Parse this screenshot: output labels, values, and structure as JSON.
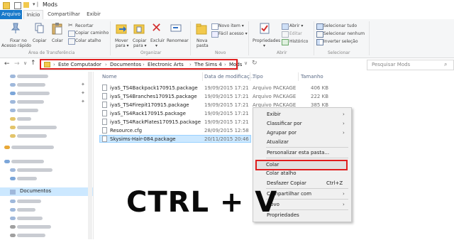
{
  "window": {
    "title": "Mods"
  },
  "ribbon_tabs": [
    "Arquivo",
    "Início",
    "Compartilhar",
    "Exibir"
  ],
  "ribbon": {
    "clipboard": {
      "pin_label_1": "Fixar no",
      "pin_label_2": "Acesso rápido",
      "copy_label": "Copiar",
      "paste_label": "Colar",
      "cut_label": "Recortar",
      "copy_path_label": "Copiar caminho",
      "paste_shortcut_label": "Colar atalho",
      "group_label": "Área de Transferência"
    },
    "organize": {
      "move_label_1": "Mover",
      "move_label_2": "para ▾",
      "copy_to_label_1": "Copiar",
      "copy_to_label_2": "para ▾",
      "delete_label_1": "Excluir",
      "delete_label_2": "▾",
      "rename_label": "Renomear",
      "group_label": "Organizar"
    },
    "new": {
      "new_folder_label_1": "Nova",
      "new_folder_label_2": "pasta",
      "new_item_label": "Novo item ▾",
      "easy_access_label": "Fácil acesso ▾",
      "group_label": "Novo"
    },
    "open": {
      "properties_label_1": "Propriedades",
      "properties_label_2": "▾",
      "open_label": "Abrir ▾",
      "edit_label": "Editar",
      "history_label": "Histórico",
      "group_label": "Abrir"
    },
    "select": {
      "select_all_label": "Selecionar tudo",
      "select_none_label": "Selecionar nenhum",
      "invert_label": "Inverter seleção",
      "group_label": "Selecionar"
    }
  },
  "address": {
    "breadcrumb": [
      "Este Computador",
      "Documentos",
      "Electronic Arts",
      "The Sims 4",
      "Mods"
    ],
    "search_placeholder": "Pesquisar Mods"
  },
  "nav_pane": {
    "selected_item": "Documentos"
  },
  "columns": {
    "name": "Nome",
    "date": "Data de modificaç...",
    "type": "Tipo",
    "size": "Tamanho"
  },
  "files": [
    {
      "name": "iyaS_TS4Backpack170915.package",
      "date": "19/09/2015 17:21",
      "type": "Arquivo PACKAGE",
      "size": "406 KB"
    },
    {
      "name": "iyaS_TS4Branches170915.package",
      "date": "19/09/2015 17:21",
      "type": "Arquivo PACKAGE",
      "size": "222 KB"
    },
    {
      "name": "iyaS_TS4Firepit170915.package",
      "date": "19/09/2015 17:21",
      "type": "Arquivo PACKAGE",
      "size": "385 KB"
    },
    {
      "name": "iyaS_TS4Rack170915.package",
      "date": "19/09/2015 17:21",
      "type": "",
      "size": ""
    },
    {
      "name": "iyaS_TS4RackPlates170915.package",
      "date": "19/09/2015 17:21",
      "type": "",
      "size": ""
    },
    {
      "name": "Resource.cfg",
      "date": "28/09/2015 12:58",
      "type": "",
      "size": ""
    },
    {
      "name": "Skysims-Hair-084.package",
      "date": "20/11/2015 20:46",
      "type": "",
      "size": ""
    }
  ],
  "context_menu": {
    "items": [
      "Exibir",
      "Classificar por",
      "Agrupar por",
      "Atualizar",
      "Personalizar esta pasta...",
      "Colar",
      "Colar atalho",
      "Desfazer Copiar",
      "Compartilhar com",
      "Novo",
      "Propriedades"
    ],
    "undo_shortcut": "Ctrl+Z"
  },
  "overlay_text": "CTRL + V",
  "colors": {
    "file_tab": "#1979ca",
    "highlight_red": "#e02020",
    "selection": "#cce8ff"
  }
}
